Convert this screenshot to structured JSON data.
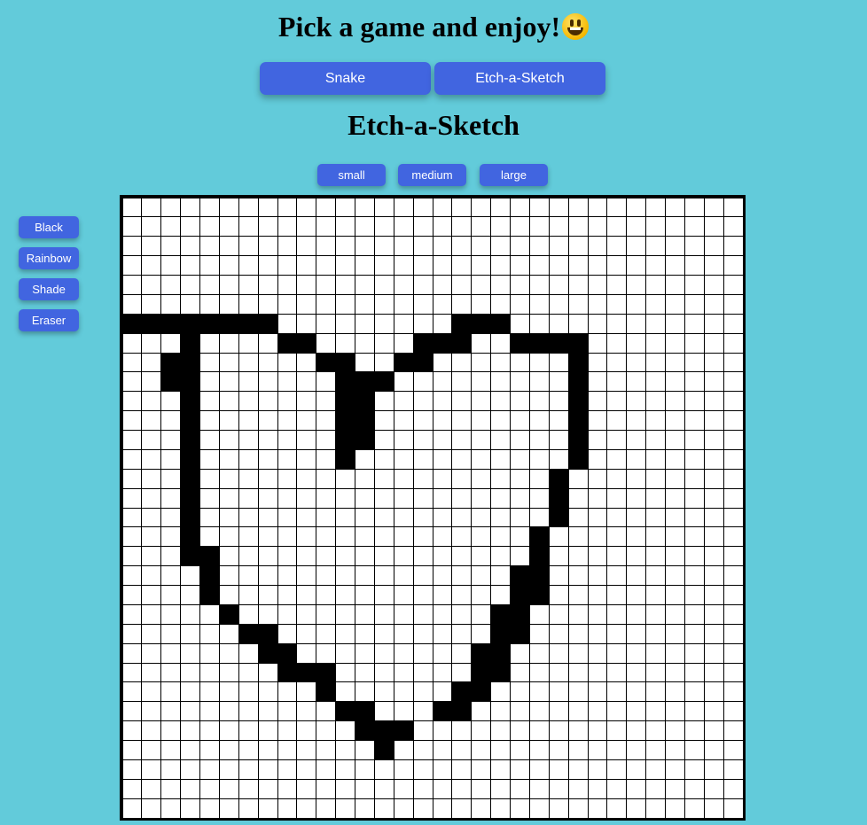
{
  "header": {
    "title": "Pick a game and enjoy!"
  },
  "games": {
    "snake_label": "Snake",
    "etch_label": "Etch-a-Sketch"
  },
  "etch": {
    "title": "Etch-a-Sketch",
    "sizes": {
      "small": "small",
      "medium": "medium",
      "large": "large"
    },
    "tools": {
      "black": "Black",
      "rainbow": "Rainbow",
      "shade": "Shade",
      "eraser": "Eraser"
    },
    "grid_size": 32,
    "drawing": [
      "................................",
      "................................",
      "................................",
      "................................",
      "................................",
      "................................",
      "########.........###............",
      "...#....##.....###..####........",
      "..##......##..##.......#........",
      "..##.......###.........#........",
      "...#.......##..........#........",
      "...#.......##..........#........",
      "...#.......##..........#........",
      "...#.......#...........#........",
      "...#..................#.........",
      "...#..................#.........",
      "...#..................#.........",
      "...#.................#..........",
      "...##................#..........",
      "....#...............##..........",
      "....#...............##..........",
      ".....#.............##...........",
      "......##...........##...........",
      ".......##.........##............",
      "........###.......##............",
      "..........#......##.............",
      "...........##...##..............",
      "............###.................",
      ".............#..................",
      "................................",
      "................................",
      "................................"
    ]
  }
}
